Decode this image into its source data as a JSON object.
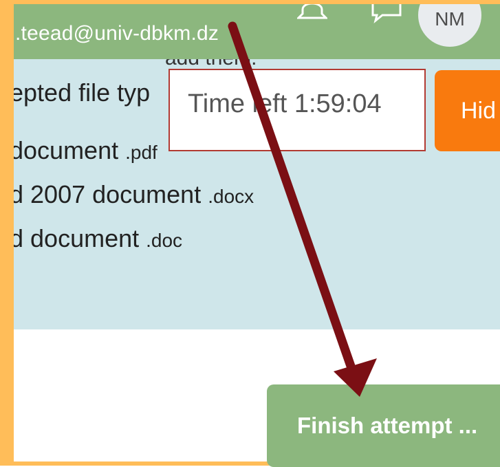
{
  "header": {
    "email": ".teead@univ-dbkm.dz",
    "avatar_initials": "NM",
    "icons": [
      "bell-icon",
      "chat-icon"
    ]
  },
  "content": {
    "partial_text": "add them.",
    "lines": [
      {
        "text": "epted file typ",
        "ext": ""
      },
      {
        "text": "document ",
        "ext": ".pdf"
      },
      {
        "text": "d 2007 document ",
        "ext": ".docx"
      },
      {
        "text": "d document ",
        "ext": ".doc"
      }
    ]
  },
  "timer": {
    "label": "Time left 1:59:04"
  },
  "buttons": {
    "hide_label": "Hid",
    "finish_label": "Finish attempt ..."
  },
  "annotation": {
    "arrow_color": "#7b0f14"
  },
  "colors": {
    "frame": "#ffbd59",
    "header_bg": "#8cb77e",
    "content_bg": "#cfe6ea",
    "hide_button_bg": "#f97a0e",
    "timer_border": "#b23a32"
  }
}
